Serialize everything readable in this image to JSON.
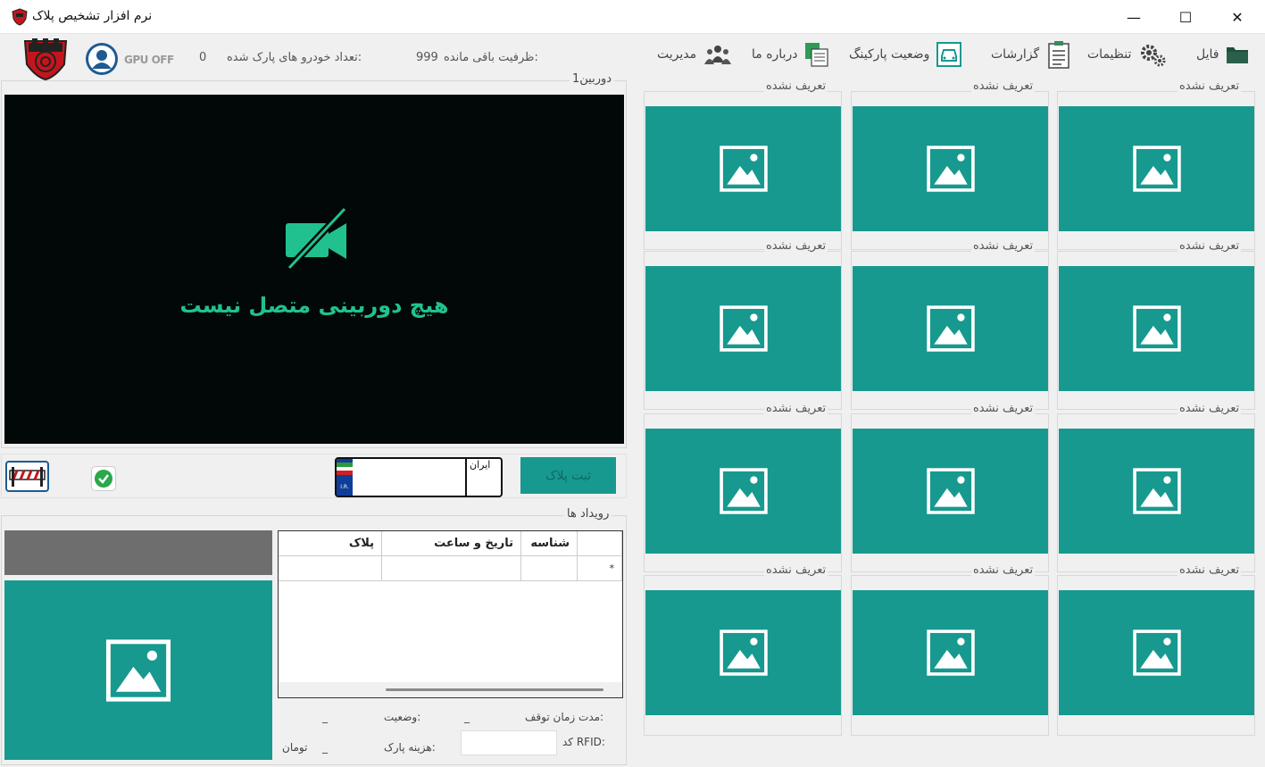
{
  "window": {
    "title": "نرم افزار تشخیص پلاک",
    "minimize": "—",
    "maximize": "☐",
    "close": "✕"
  },
  "menu": {
    "file": "فایل",
    "settings": "تنظیمات",
    "reports": "گزارشات",
    "parking_status": "وضعیت پارکینگ",
    "about": "درباره ما",
    "management": "مدیریت"
  },
  "status_bar": {
    "capacity_label": "ظرفیت باقی مانده:",
    "capacity_value": "999",
    "parked_label": "تعداد خودرو های پارک شده:",
    "parked_value": "0",
    "gpu": "GPU OFF"
  },
  "camera": {
    "group_title": "دوربین1",
    "no_camera_message": "هیچ دوربینی متصل نیست"
  },
  "plate": {
    "country": "ایران",
    "register_button": "ثبت پلاک"
  },
  "events": {
    "group_title": "رویداد ها",
    "columns": [
      "شناسه",
      "تاریخ و ساعت",
      "پلاک"
    ],
    "new_row_marker": "*",
    "stop_duration_label": "مدت زمان توقف:",
    "stop_duration_value": "_",
    "status_label": "وضعیت:",
    "status_value": "_",
    "rfid_label": "کد RFID:",
    "fee_label": "هزینه پارک:",
    "fee_value": "_",
    "currency": "تومان"
  },
  "thumbnails": {
    "undefined_label": "تعریف نشده"
  },
  "colors": {
    "teal": "#17998f",
    "camera_bg": "#020808",
    "camera_text": "#21c18f"
  }
}
